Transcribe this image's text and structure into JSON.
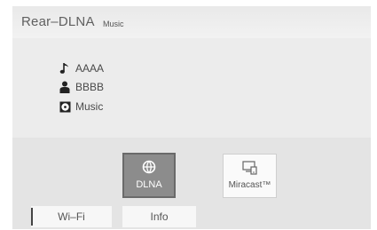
{
  "header": {
    "title": "Rear–DLNA",
    "source": "Music"
  },
  "track": {
    "song": "AAAA",
    "artist": "BBBB",
    "album": "Music",
    "song_icon": "music-note-icon",
    "artist_icon": "person-icon",
    "album_icon": "disc-icon"
  },
  "buttons": {
    "dlna_label": "DLNA",
    "dlna_icon": "dlna-network-icon",
    "miracast_label": "Miracast™",
    "miracast_icon": "screen-cast-icon"
  },
  "tabs": {
    "wifi_label": "Wi–Fi",
    "info_label": "Info",
    "active": "Wi–Fi"
  },
  "colors": {
    "active_button": "#8c8c8c",
    "background": "#ececec"
  }
}
